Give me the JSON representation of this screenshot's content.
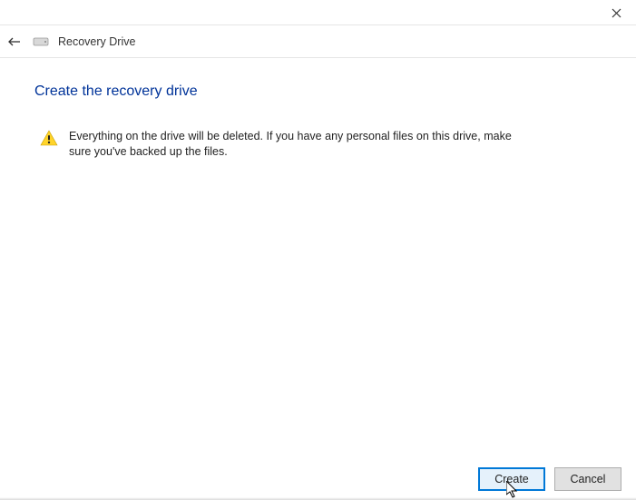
{
  "window": {
    "title": "Recovery Drive"
  },
  "content": {
    "heading": "Create the recovery drive",
    "warning": "Everything on the drive will be deleted. If you have any personal files on this drive, make sure you've backed up the files."
  },
  "footer": {
    "primary_button": "Create",
    "cancel_button": "Cancel"
  }
}
